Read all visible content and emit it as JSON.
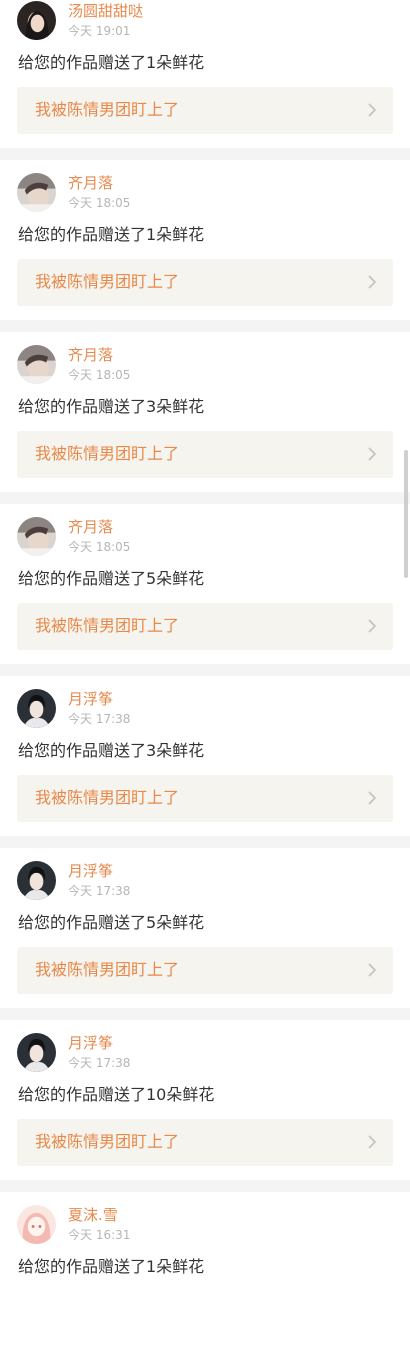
{
  "notifications": [
    {
      "username": "汤圆甜甜哒",
      "time": "今天 19:01",
      "message": "给您的作品赠送了1朵鲜花",
      "work_title": "我被陈情男团盯上了",
      "avatar": "avatar-girl-dark-hair"
    },
    {
      "username": "齐月落",
      "time": "今天 18:05",
      "message": "给您的作品赠送了1朵鲜花",
      "work_title": "我被陈情男团盯上了",
      "avatar": "avatar-boy-photo"
    },
    {
      "username": "齐月落",
      "time": "今天 18:05",
      "message": "给您的作品赠送了3朵鲜花",
      "work_title": "我被陈情男团盯上了",
      "avatar": "avatar-boy-photo"
    },
    {
      "username": "齐月落",
      "time": "今天 18:05",
      "message": "给您的作品赠送了5朵鲜花",
      "work_title": "我被陈情男团盯上了",
      "avatar": "avatar-boy-photo"
    },
    {
      "username": "月浮筝",
      "time": "今天 17:38",
      "message": "给您的作品赠送了3朵鲜花",
      "work_title": "我被陈情男团盯上了",
      "avatar": "avatar-costume-dark"
    },
    {
      "username": "月浮筝",
      "time": "今天 17:38",
      "message": "给您的作品赠送了5朵鲜花",
      "work_title": "我被陈情男团盯上了",
      "avatar": "avatar-costume-dark"
    },
    {
      "username": "月浮筝",
      "time": "今天 17:38",
      "message": "给您的作品赠送了10朵鲜花",
      "work_title": "我被陈情男团盯上了",
      "avatar": "avatar-costume-dark"
    },
    {
      "username": "夏沫.雪",
      "time": "今天 16:31",
      "message": "给您的作品赠送了1朵鲜花",
      "work_title": "",
      "avatar": "avatar-anime-girl"
    }
  ],
  "colors": {
    "username": "#e88a4e",
    "work_title": "#e8894a",
    "card_link_bg": "#f5f4ee",
    "separator": "#f4f4f4"
  }
}
